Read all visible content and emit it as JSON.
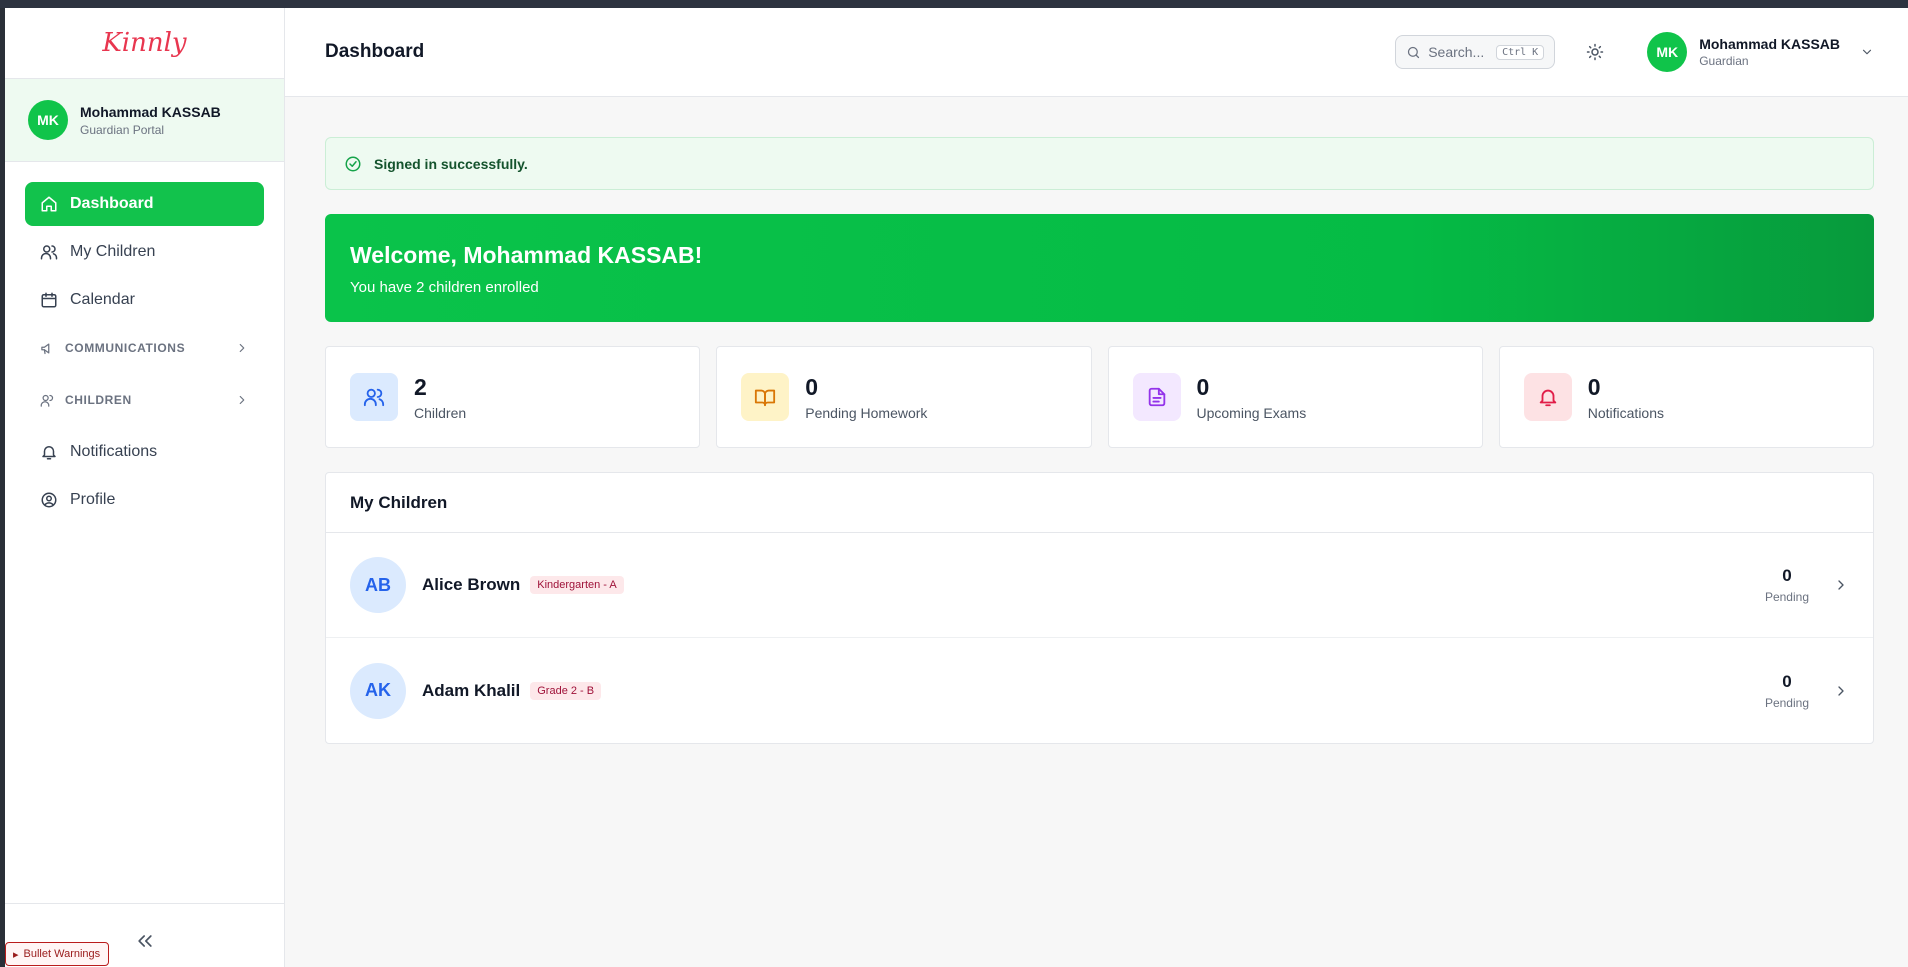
{
  "app": {
    "brand": "Kinnly"
  },
  "sidebar": {
    "user": {
      "initials": "MK",
      "name": "Mohammad KASSAB",
      "portal": "Guardian Portal"
    },
    "items": [
      {
        "label": "Dashboard",
        "icon": "home-icon",
        "active": true
      },
      {
        "label": "My Children",
        "icon": "users-icon"
      },
      {
        "label": "Calendar",
        "icon": "calendar-icon"
      },
      {
        "label": "COMMUNICATIONS",
        "icon": "megaphone-icon",
        "section": true
      },
      {
        "label": "CHILDREN",
        "icon": "users-icon",
        "section": true
      },
      {
        "label": "Notifications",
        "icon": "bell-icon"
      },
      {
        "label": "Profile",
        "icon": "user-circle-icon"
      }
    ],
    "collapse_icon": "double-chevron-left-icon"
  },
  "debug": {
    "bullet_warnings": "Bullet Warnings"
  },
  "header": {
    "title": "Dashboard",
    "search": {
      "placeholder": "Search...",
      "shortcut": "Ctrl K"
    },
    "theme_icon": "sun-icon",
    "user": {
      "initials": "MK",
      "name": "Mohammad KASSAB",
      "role": "Guardian"
    }
  },
  "alert": {
    "message": "Signed in successfully."
  },
  "welcome": {
    "title": "Welcome, Mohammad KASSAB!",
    "subtitle": "You have 2 children enrolled"
  },
  "stats": [
    {
      "value": "2",
      "label": "Children",
      "icon": "users-icon",
      "color": "#2563eb",
      "bg": "#dbeafe"
    },
    {
      "value": "0",
      "label": "Pending Homework",
      "icon": "book-open-icon",
      "color": "#d97706",
      "bg": "#fef3c7"
    },
    {
      "value": "0",
      "label": "Upcoming Exams",
      "icon": "file-text-icon",
      "color": "#9333ea",
      "bg": "#f3e8ff"
    },
    {
      "value": "0",
      "label": "Notifications",
      "icon": "bell-icon",
      "color": "#e11d48",
      "bg": "#fde2e4"
    }
  ],
  "children": {
    "title": "My Children",
    "list": [
      {
        "initials": "AB",
        "name": "Alice Brown",
        "class": "Kindergarten - A",
        "pending": "0",
        "pending_label": "Pending"
      },
      {
        "initials": "AK",
        "name": "Adam Khalil",
        "class": "Grade 2 - B",
        "pending": "0",
        "pending_label": "Pending"
      }
    ]
  },
  "colors": {
    "primary": "#12c24c",
    "brand": "#e8364f"
  }
}
